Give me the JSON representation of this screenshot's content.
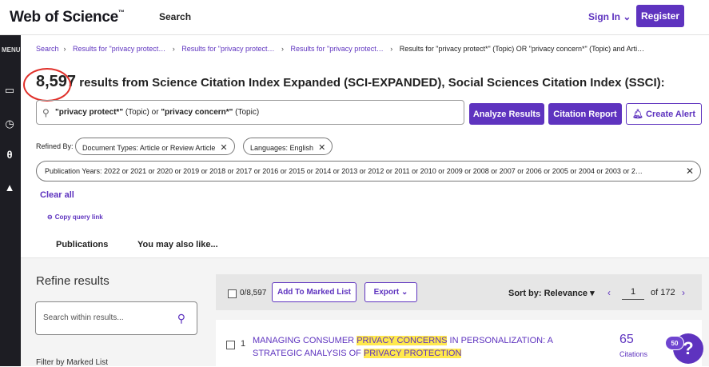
{
  "header": {
    "logo": "Web of Science",
    "logo_mark": "™",
    "search_link": "Search",
    "sign_in": "Sign In",
    "register": "Register"
  },
  "rail": {
    "menu_label": "MENU"
  },
  "breadcrumbs": [
    "Search",
    "Results for \"privacy protect… ",
    "Results for \"privacy protect… ",
    "Results for \"privacy protect… ",
    "Results for \"privacy protect*\" (Topic) OR \"privacy concern*\" (Topic) and Arti…"
  ],
  "results": {
    "count": "8,597",
    "text": " results from Science Citation Index Expanded (SCI-EXPANDED), Social Sciences Citation Index (SSCI):"
  },
  "query": {
    "term1": "\"privacy protect*\"",
    "field1": " (Topic) or ",
    "term2": "\"privacy concern*\"",
    "field2": " (Topic)"
  },
  "actions": {
    "analyze": "Analyze Results",
    "citation_report": "Citation Report",
    "create_alert": "Create Alert"
  },
  "refined": {
    "label": "Refined By:",
    "doc_types": "Document Types: Article or Review Article",
    "languages": "Languages: English",
    "years": "Publication Years: 2022 or 2021 or 2020 or 2019 or 2018 or 2017 or 2016 or 2015 or 2014 or 2013 or 2012 or 2011 or 2010 or 2009 or 2008 or 2007 or 2006 or 2005 or 2004 or 2003 or 2…",
    "clear_all": "Clear all",
    "copy_link": "Copy query link"
  },
  "tabs": {
    "publications": "Publications",
    "also_like": "You may also like..."
  },
  "sidebar": {
    "refine_title": "Refine results",
    "search_placeholder": "Search within results...",
    "filter_marked": "Filter by Marked List"
  },
  "toolbar": {
    "selected": "0/8,597",
    "add_marked": "Add To Marked List",
    "export": "Export",
    "sort": "Sort by: Relevance",
    "page": "1",
    "of_pages": "of 172"
  },
  "result1": {
    "number": "1",
    "title_a": "MANAGING CONSUMER ",
    "title_hl1": "PRIVACY CONCERNS",
    "title_b": " IN PERSONALIZATION: A STRATEGIC ANALYSIS OF ",
    "title_hl2": "PRIVACY PROTECTION",
    "citations": "65",
    "citations_label": "Citations"
  },
  "help": {
    "badge": "50",
    "icon": "?"
  },
  "colors": {
    "brand": "#5e33bf",
    "highlight": "#ffe94d",
    "annotation": "#e0302a"
  }
}
